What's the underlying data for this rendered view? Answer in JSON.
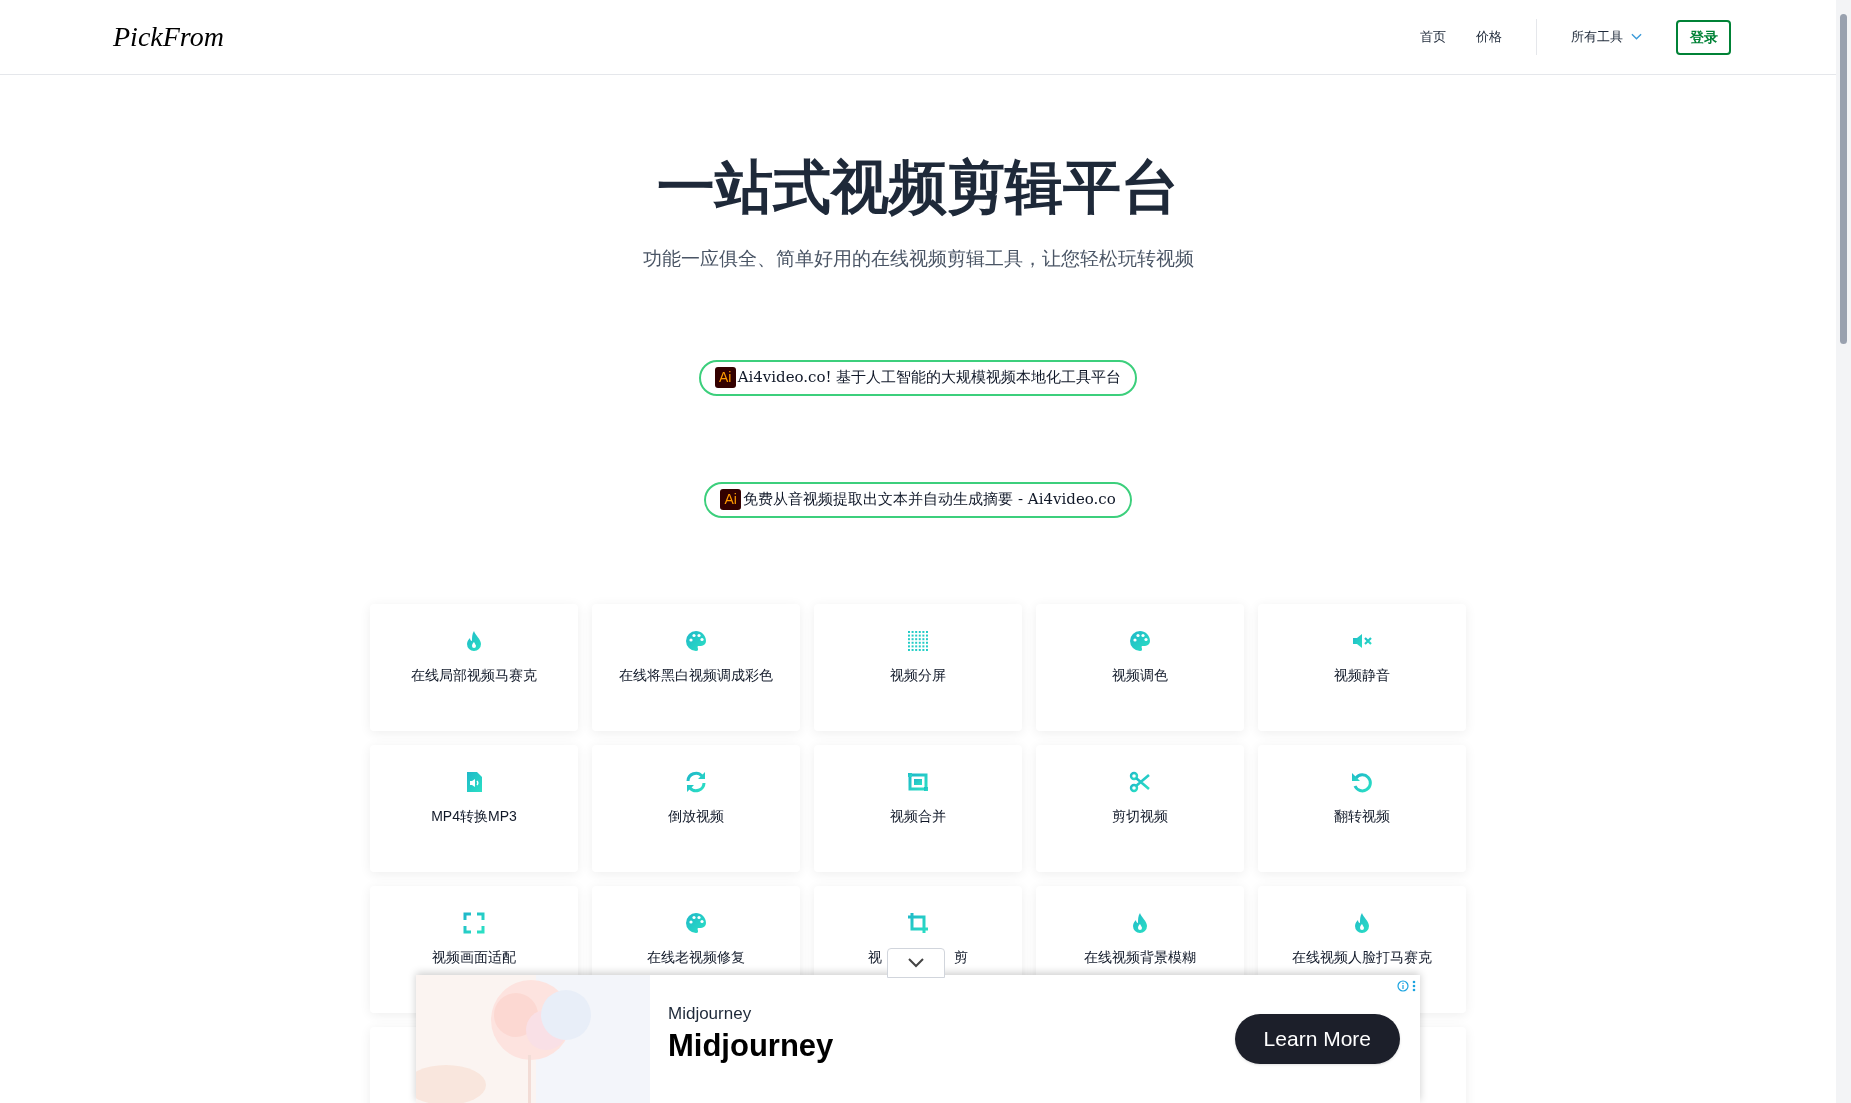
{
  "header": {
    "logo": "PickFrom",
    "nav": [
      {
        "label": "首页"
      },
      {
        "label": "价格"
      }
    ],
    "tools_menu": {
      "label": "所有工具",
      "expanded": false
    },
    "login": "登录"
  },
  "hero": {
    "title": "一站式视频剪辑平台",
    "subtitle": "功能一应俱全、简单好用的在线视频剪辑工具，让您轻松玩转视频"
  },
  "promos": [
    {
      "badge": "Ai",
      "text": "Ai4video.co! 基于人工智能的大规模视频本地化工具平台"
    },
    {
      "badge": "Ai",
      "text": "免费从音视频提取出文本并自动生成摘要 - Ai4video.co"
    }
  ],
  "tools": [
    {
      "kind": "droplet",
      "label": "在线局部视频马赛克"
    },
    {
      "kind": "palette",
      "label": "在线将黑白视频调成彩色"
    },
    {
      "kind": "dots",
      "label": "视频分屏"
    },
    {
      "kind": "palette",
      "label": "视频调色"
    },
    {
      "kind": "mute",
      "label": "视频静音"
    },
    {
      "kind": "audiofile",
      "label": "MP4转换MP3"
    },
    {
      "kind": "refresh",
      "label": "倒放视频"
    },
    {
      "kind": "merge",
      "label": "视频合并"
    },
    {
      "kind": "scissors",
      "label": "剪切视频"
    },
    {
      "kind": "undo",
      "label": "翻转视频"
    },
    {
      "kind": "expand",
      "label": "视频画面适配"
    },
    {
      "kind": "palette",
      "label": "在线老视频修复"
    },
    {
      "kind": "crop",
      "label": "视",
      "label_tail": "剪"
    },
    {
      "kind": "droplet",
      "label": "在线视频背景模糊"
    },
    {
      "kind": "droplet",
      "label": "在线视频人脸打马赛克"
    }
  ],
  "ad": {
    "advertiser": "Midjourney",
    "headline": "Midjourney",
    "button": "Learn More",
    "collapsed": false
  }
}
